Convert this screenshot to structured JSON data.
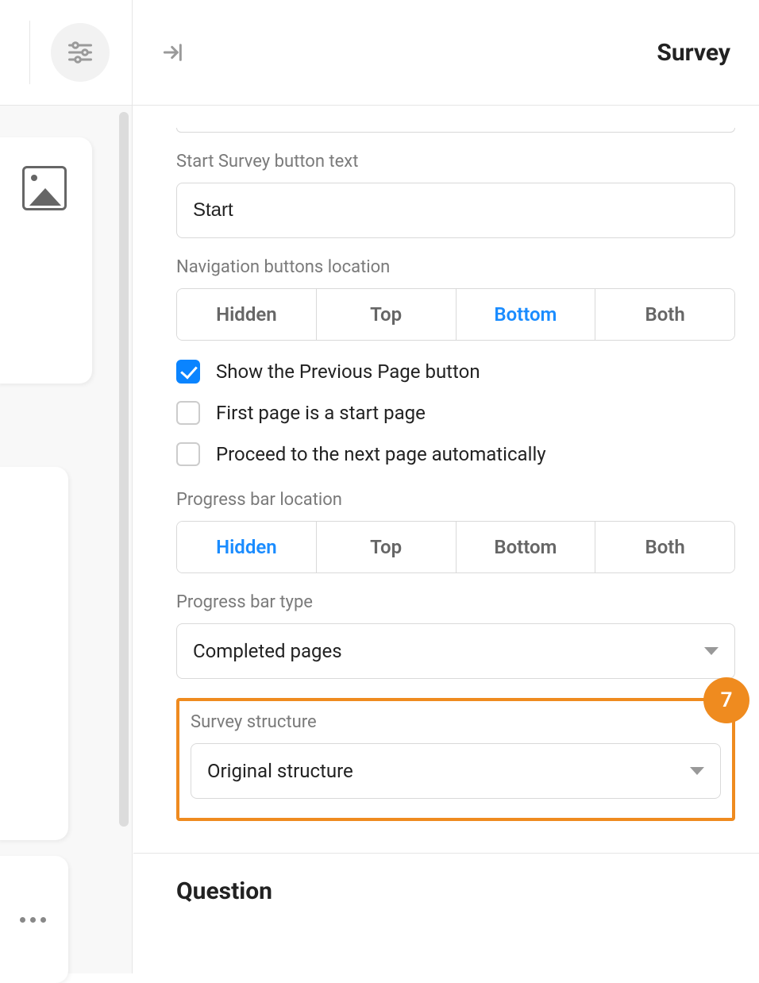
{
  "header": {
    "title": "Survey"
  },
  "form": {
    "start_button": {
      "label": "Start Survey button text",
      "value": "Start"
    },
    "nav_location": {
      "label": "Navigation buttons location",
      "options": [
        "Hidden",
        "Top",
        "Bottom",
        "Both"
      ],
      "selected": "Bottom"
    },
    "show_previous": {
      "label": "Show the Previous Page button",
      "checked": true
    },
    "first_page_start": {
      "label": "First page is a start page",
      "checked": false
    },
    "auto_next": {
      "label": "Proceed to the next page automatically",
      "checked": false
    },
    "progress_location": {
      "label": "Progress bar location",
      "options": [
        "Hidden",
        "Top",
        "Bottom",
        "Both"
      ],
      "selected": "Hidden"
    },
    "progress_type": {
      "label": "Progress bar type",
      "value": "Completed pages"
    },
    "survey_structure": {
      "label": "Survey structure",
      "value": "Original structure"
    }
  },
  "highlight": {
    "badge": "7"
  },
  "sections": {
    "question": "Question"
  }
}
